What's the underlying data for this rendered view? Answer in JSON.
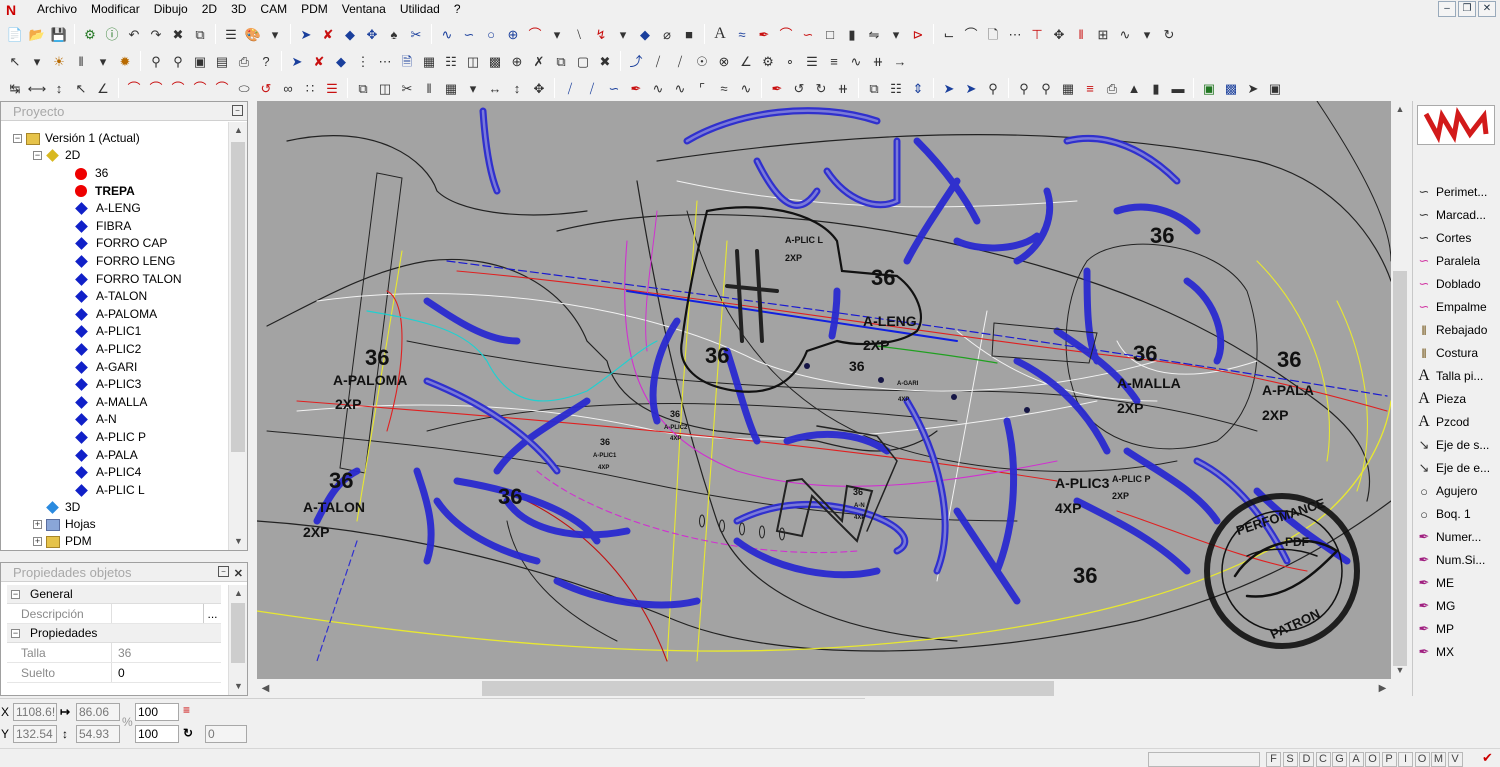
{
  "menu": [
    "Archivo",
    "Modificar",
    "Dibujo",
    "2D",
    "3D",
    "CAM",
    "PDM",
    "Ventana",
    "Utilidad",
    "?"
  ],
  "panels": {
    "project_title": "Proyecto",
    "props_title": "Propiedades objetos"
  },
  "tree": {
    "root": "Versión 1 (Actual)",
    "node_2d": "2D",
    "items": [
      {
        "label": "36",
        "marker": "red",
        "bold": false
      },
      {
        "label": "TREPA",
        "marker": "red",
        "bold": true
      },
      {
        "label": "A-LENG",
        "marker": "blue"
      },
      {
        "label": "FIBRA",
        "marker": "blue"
      },
      {
        "label": "FORRO CAP",
        "marker": "blue"
      },
      {
        "label": "FORRO LENG",
        "marker": "blue"
      },
      {
        "label": "FORRO TALON",
        "marker": "blue"
      },
      {
        "label": "A-TALON",
        "marker": "blue"
      },
      {
        "label": "A-PALOMA",
        "marker": "blue"
      },
      {
        "label": "A-PLIC1",
        "marker": "blue"
      },
      {
        "label": "A-PLIC2",
        "marker": "blue"
      },
      {
        "label": "A-GARI",
        "marker": "blue"
      },
      {
        "label": "A-PLIC3",
        "marker": "blue"
      },
      {
        "label": "A-MALLA",
        "marker": "blue"
      },
      {
        "label": "A-N",
        "marker": "blue"
      },
      {
        "label": "A-PLIC P",
        "marker": "blue"
      },
      {
        "label": "A-PALA",
        "marker": "blue"
      },
      {
        "label": "A-PLIC4",
        "marker": "blue"
      },
      {
        "label": "A-PLIC L",
        "marker": "blue"
      }
    ],
    "node_3d": "3D",
    "node_hojas": "Hojas",
    "node_pdm": "PDM"
  },
  "props": {
    "cat_general": "General",
    "descripcion_label": "Descripción",
    "descripcion_value": "",
    "descripcion_btn": "...",
    "cat_propiedades": "Propiedades",
    "talla_label": "Talla",
    "talla_value": "36",
    "suelto_label": "Suelto",
    "suelto_value": "0"
  },
  "canvas_labels": [
    {
      "t": "A-PLIC L",
      "size": "s"
    },
    {
      "t": "2XP",
      "size": "s"
    },
    {
      "t": "36",
      "size": "l"
    },
    {
      "t": "A-LENG",
      "size": "m"
    },
    {
      "t": "2XP",
      "size": "m"
    },
    {
      "t": "36",
      "size": "l"
    },
    {
      "t": "36",
      "size": "m"
    },
    {
      "t": "A-GARI",
      "size": "xs"
    },
    {
      "t": "4XP",
      "size": "xs"
    },
    {
      "t": "36",
      "size": "l"
    },
    {
      "t": "A-PALOMA",
      "size": "m"
    },
    {
      "t": "2XP",
      "size": "m"
    },
    {
      "t": "36",
      "size": "l"
    },
    {
      "t": "A-TALON",
      "size": "m"
    },
    {
      "t": "2XP",
      "size": "m"
    },
    {
      "t": "36",
      "size": "l"
    },
    {
      "t": "36",
      "size": "s"
    },
    {
      "t": "A-PLIC2",
      "size": "xs"
    },
    {
      "t": "4XP",
      "size": "xs"
    },
    {
      "t": "36",
      "size": "s"
    },
    {
      "t": "A-PLIC1",
      "size": "xs"
    },
    {
      "t": "4XP",
      "size": "xs"
    },
    {
      "t": "36",
      "size": "s"
    },
    {
      "t": "A-N",
      "size": "xs"
    },
    {
      "t": "4XP",
      "size": "xs"
    },
    {
      "t": "36",
      "size": "l"
    },
    {
      "t": "A-MALLA",
      "size": "m"
    },
    {
      "t": "2XP",
      "size": "m"
    },
    {
      "t": "36",
      "size": "l"
    },
    {
      "t": "A-PALA",
      "size": "m"
    },
    {
      "t": "2XP",
      "size": "m"
    },
    {
      "t": "36",
      "size": "l"
    },
    {
      "t": "A-PLIC3",
      "size": "m"
    },
    {
      "t": "4XP",
      "size": "m"
    },
    {
      "t": "A-PLIC P",
      "size": "s"
    },
    {
      "t": "2XP",
      "size": "s"
    },
    {
      "t": "36",
      "size": "l"
    }
  ],
  "watermark": {
    "top": "PERFOMANCE",
    "center": "PDF",
    "bottom": "PATRON"
  },
  "right_panel": [
    {
      "icon": "line-curve-icon",
      "label": "Perimet..."
    },
    {
      "icon": "line-curve-icon",
      "label": "Marcad..."
    },
    {
      "icon": "line-curve-icon",
      "label": "Cortes"
    },
    {
      "icon": "pink-curve-icon",
      "label": "Paralela"
    },
    {
      "icon": "pink-curve-icon",
      "label": "Doblado"
    },
    {
      "icon": "pink-curve-icon",
      "label": "Empalme"
    },
    {
      "icon": "stitch-icon",
      "label": "Rebajado"
    },
    {
      "icon": "stitch-icon",
      "label": "Costura"
    },
    {
      "icon": "text-a-icon",
      "label": "Talla pi..."
    },
    {
      "icon": "text-a-icon",
      "label": "Pieza"
    },
    {
      "icon": "text-a-icon",
      "label": "Pzcod"
    },
    {
      "icon": "axis-icon",
      "label": "Eje de s..."
    },
    {
      "icon": "axis-icon",
      "label": "Eje de e..."
    },
    {
      "icon": "circle-icon",
      "label": "Agujero"
    },
    {
      "icon": "circle-icon",
      "label": "Boq. 1"
    },
    {
      "icon": "pen-icon",
      "label": "Numer..."
    },
    {
      "icon": "pen-icon",
      "label": "Num.Si..."
    },
    {
      "icon": "pen-icon",
      "label": "ME"
    },
    {
      "icon": "pen-icon",
      "label": "MG"
    },
    {
      "icon": "pen-icon",
      "label": "MP"
    },
    {
      "icon": "pen-icon",
      "label": "MX"
    }
  ],
  "coords": {
    "x_label": "X",
    "x_value": "1108.6!",
    "dx_value": "86.06",
    "zoom1": "100",
    "y_label": "Y",
    "y_value": "132.54",
    "dy_value": "54.93",
    "zoom2": "100",
    "angle": "0",
    "percent": "%"
  },
  "status": {
    "letters": [
      "F",
      "S",
      "D",
      "C",
      "G",
      "A",
      "O",
      "P",
      "I",
      "O",
      "M",
      "V"
    ]
  }
}
